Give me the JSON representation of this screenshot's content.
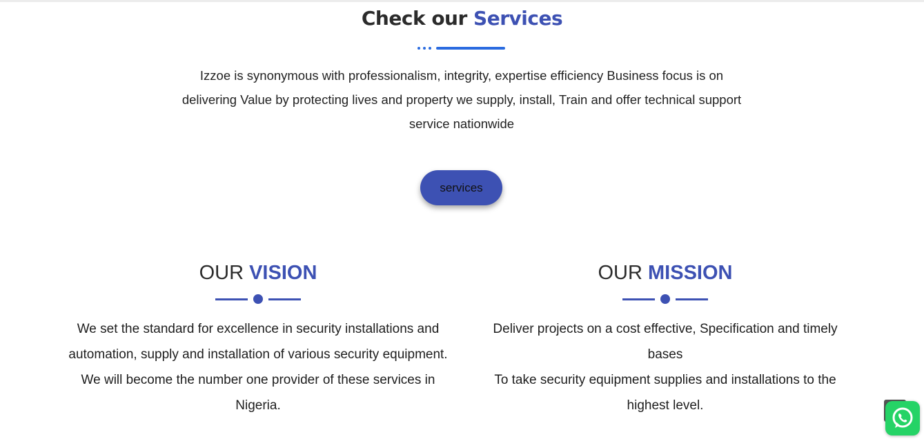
{
  "services": {
    "title_dark": "Check our",
    "title_accent": "Services",
    "intro": "Izzoe is synonymous with professionalism, integrity, expertise efficiency Business focus is on delivering Value by protecting lives and property we supply, install, Train and offer technical support service nationwide",
    "button_label": "services"
  },
  "vision": {
    "title_dark": "OUR",
    "title_accent": "VISION",
    "text": "We set the standard for excellence in security installations and automation, supply and installation of various security equipment.  We will become the number one provider of these services in Nigeria."
  },
  "mission": {
    "title_dark": "OUR",
    "title_accent": "MISSION",
    "text_1": "Deliver projects on a cost effective, Specification and timely bases",
    "text_2": "To take security equipment supplies and installations to the highest level."
  },
  "colors": {
    "accent": "#3d51b3",
    "divider_blue": "#2a6be0",
    "whatsapp_green": "#25d366"
  },
  "icons": {
    "whatsapp": "whatsapp-icon",
    "scroll_top": "scroll-to-top-icon"
  }
}
